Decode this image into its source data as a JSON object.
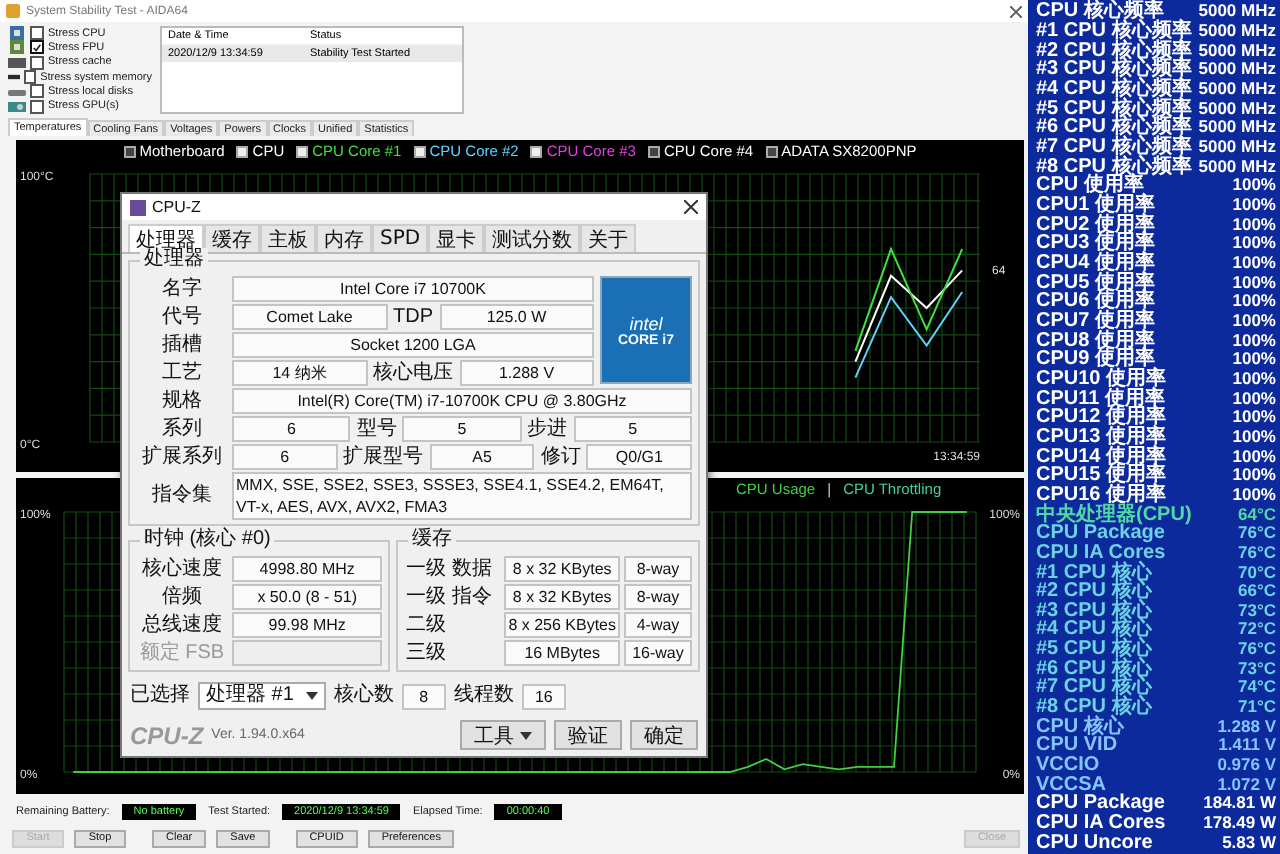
{
  "window": {
    "title": "System Stability Test - AIDA64"
  },
  "stress_options": [
    {
      "label": "Stress CPU",
      "checked": false,
      "kind": "cpu"
    },
    {
      "label": "Stress FPU",
      "checked": true,
      "kind": "fpu"
    },
    {
      "label": "Stress cache",
      "checked": false,
      "kind": "cache"
    },
    {
      "label": "Stress system memory",
      "checked": false,
      "kind": "memory"
    },
    {
      "label": "Stress local disks",
      "checked": false,
      "kind": "disk"
    },
    {
      "label": "Stress GPU(s)",
      "checked": false,
      "kind": "gpu"
    }
  ],
  "log": {
    "columns": [
      "Date & Time",
      "Status"
    ],
    "rows": [
      [
        "2020/12/9 13:34:59",
        "Stability Test Started"
      ]
    ]
  },
  "tabs": [
    {
      "label": "Temperatures",
      "selected": true
    },
    {
      "label": "Cooling Fans",
      "selected": false
    },
    {
      "label": "Voltages",
      "selected": false
    },
    {
      "label": "Powers",
      "selected": false
    },
    {
      "label": "Clocks",
      "selected": false
    },
    {
      "label": "Unified",
      "selected": false
    },
    {
      "label": "Statistics",
      "selected": false
    }
  ],
  "temperature_chart": {
    "legend": [
      {
        "label": "Motherboard",
        "color": "#ffffff",
        "checked": false
      },
      {
        "checked": true
      },
      {
        "checked": true
      },
      {
        "checked": true
      },
      {
        "label": "CPU Core #3",
        "color": "#e040e0",
        "checked": true
      },
      {
        "label": "CPU Core #4",
        "color": "#ffffff",
        "checked": false
      },
      {
        "label": "ADATA SX8200PNP",
        "color": "#ffffff",
        "checked": false
      }
    ],
    "time_label": "13:34:59",
    "chart_data": {
      "type": "line",
      "grid": true,
      "categories": [
        null,
        null,
        null,
        null,
        null,
        null,
        null,
        null,
        null,
        null,
        null,
        null,
        null,
        null,
        null,
        null,
        null,
        null,
        null,
        null,
        null,
        null,
        null,
        null,
        null
      ],
      "ylim": [
        0,
        100
      ],
      "yticks": [
        {
          "value": 100,
          "label": "100°C"
        },
        {
          "value": 0,
          "label": "0°C"
        }
      ],
      "series": [
        {
          "name": "CPU",
          "color": "#ffffff",
          "values": [
            null,
            null,
            null,
            null,
            null,
            null,
            null,
            null,
            null,
            null,
            null,
            null,
            null,
            null,
            null,
            null,
            null,
            null,
            null,
            null,
            null,
            30,
            62,
            50,
            64
          ]
        },
        {
          "name": "CPU Core #1",
          "color": "#40e040",
          "values": [
            null,
            null,
            null,
            null,
            null,
            null,
            null,
            null,
            null,
            null,
            null,
            null,
            null,
            null,
            null,
            null,
            null,
            null,
            null,
            null,
            null,
            34,
            72,
            42,
            72
          ]
        },
        {
          "name": "CPU Core #2",
          "color": "#60d0ff",
          "values": [
            null,
            null,
            null,
            null,
            null,
            null,
            null,
            null,
            null,
            null,
            null,
            null,
            null,
            null,
            null,
            null,
            null,
            null,
            null,
            null,
            null,
            24,
            54,
            36,
            56
          ]
        }
      ],
      "annotations": [
        {
          "text": "64"
        }
      ]
    }
  },
  "usage_chart": {
    "separator": "|",
    "right_ticks": [
      "100%",
      "0%"
    ],
    "chart_data": {
      "type": "line",
      "grid": true,
      "categories": [
        null,
        null,
        null,
        null,
        null,
        null,
        null,
        null,
        null,
        null,
        null,
        null,
        null,
        null,
        null,
        null,
        null,
        null,
        null,
        null,
        null,
        null,
        null,
        null,
        null,
        null,
        null,
        null,
        null,
        null,
        null,
        null,
        null,
        null,
        null,
        null,
        null,
        null,
        null,
        null,
        null,
        null,
        null,
        null,
        null,
        null,
        null,
        null,
        null,
        null
      ],
      "ylim": [
        0,
        100
      ],
      "yticks": [
        {
          "value": 100,
          "label": "100%"
        },
        {
          "value": 0,
          "label": "0%"
        }
      ],
      "series": [
        {
          "name": "CPU Usage",
          "color": "#40d040",
          "values": [
            0,
            0,
            0,
            0,
            0,
            0,
            0,
            0,
            0,
            0,
            0,
            0,
            0,
            0,
            0,
            0,
            0,
            0,
            0,
            0,
            0,
            0,
            0,
            0,
            0,
            0,
            0,
            0,
            0,
            0,
            0,
            0,
            0,
            0,
            0,
            0,
            0,
            2,
            5,
            1,
            3,
            2,
            1,
            2,
            2,
            2,
            100,
            100,
            100,
            100
          ]
        },
        {
          "name": "CPU Throttling",
          "color": "#40d0a0",
          "values": [
            null,
            null,
            null,
            null,
            null,
            null,
            null,
            null,
            null,
            null,
            null,
            null,
            null,
            null,
            null,
            null,
            null,
            null,
            null,
            null,
            null,
            null,
            null,
            null,
            null,
            null,
            null,
            null,
            null,
            null,
            null,
            null,
            null,
            null,
            null,
            null,
            null,
            null,
            null,
            null,
            null,
            null,
            null,
            null,
            null,
            null,
            null,
            null,
            null,
            null
          ]
        }
      ]
    }
  },
  "cpuz": {
    "title": "CPU-Z",
    "tabs": [
      {
        "label": "处理器",
        "selected": true
      },
      {
        "label": "缓存",
        "selected": false
      },
      {
        "label": "主板",
        "selected": false
      },
      {
        "label": "内存",
        "selected": false
      },
      {
        "label": "SPD",
        "selected": false
      },
      {
        "label": "显卡",
        "selected": false
      },
      {
        "label": "测试分数",
        "selected": false
      },
      {
        "label": "关于",
        "selected": false
      }
    ],
    "processor": {
      "heading": "处理器",
      "logo": {
        "brand": "intel",
        "line": "CORE i7"
      },
      "rows": [
        [
          {
            "label": "名字",
            "value": "Intel Core i7 10700K"
          }
        ],
        [
          {
            "label": "代号",
            "value": "Comet Lake"
          },
          {
            "label": "TDP",
            "value": "125.0 W"
          }
        ],
        [
          {
            "label": "插槽",
            "value": "Socket 1200 LGA"
          }
        ],
        [
          {
            "label": "工艺",
            "value": "14 纳米"
          },
          {
            "label": "核心电压",
            "value": "1.288 V"
          }
        ],
        [
          {
            "label": "规格",
            "value": "Intel(R) Core(TM) i7-10700K CPU @ 3.80GHz"
          }
        ],
        [
          {
            "label": "系列",
            "value": "6"
          },
          {
            "label": "型号",
            "value": "5"
          },
          {
            "label": "步进",
            "value": "5"
          }
        ],
        [
          {
            "label": "扩展系列",
            "value": "6"
          },
          {
            "label": "扩展型号",
            "value": "A5"
          },
          {
            "label": "修订",
            "value": "Q0/G1"
          }
        ],
        [
          {
            "label": "指令集",
            "value": "MMX, SSE, SSE2, SSE3, SSSE3, SSE4.1, SSE4.2, EM64T, VT-x, AES, AVX, AVX2, FMA3"
          }
        ]
      ]
    },
    "clocks": {
      "heading": "时钟 (核心 #0)",
      "rows": [
        {
          "label": "核心速度",
          "value": "4998.80 MHz",
          "disabled": false
        },
        {
          "label": "倍频",
          "value": "x 50.0 (8 - 51)",
          "disabled": false
        },
        {
          "label": "总线速度",
          "value": "99.98 MHz",
          "disabled": false
        },
        {
          "label": "额定 FSB",
          "disabled": true
        }
      ]
    },
    "cache": {
      "heading": "缓存",
      "rows": [
        [
          "一级 数据",
          "8 x 32 KBytes",
          "8-way"
        ],
        [
          "一级 指令",
          "8 x 32 KBytes",
          "8-way"
        ],
        [
          "二级",
          "8 x 256 KBytes",
          "4-way"
        ],
        [
          "三级",
          "16 MBytes",
          "16-way"
        ]
      ]
    },
    "selection": {
      "label": "已选择",
      "value": "处理器 #1",
      "cores_label": "核心数",
      "cores": "8",
      "threads_label": "线程数",
      "threads": "16"
    },
    "footer": {
      "brand": "CPU-Z",
      "version": "Ver. 1.94.0.x64",
      "buttons": [
        "工具",
        "验证",
        "确定"
      ]
    }
  },
  "status": [
    {
      "label": "Remaining Battery:",
      "value": "No battery"
    },
    {
      "label": "Test Started:",
      "value": "2020/12/9 13:34:59"
    },
    {
      "label": "Elapsed Time:",
      "value": "00:00:40"
    }
  ],
  "buttons": [
    {
      "label": "Start",
      "disabled": true
    },
    {
      "label": "Stop",
      "disabled": false
    },
    {
      "label": "Clear",
      "disabled": false
    },
    {
      "label": "Save",
      "disabled": false
    },
    {
      "label": "CPUID",
      "disabled": false
    },
    {
      "label": "Preferences",
      "disabled": false
    },
    {
      "label": "Close",
      "disabled": true
    }
  ],
  "sensors": [
    {
      "label": "CPU 核心频率",
      "value": "5000 MHz",
      "color": "#ffffff"
    },
    {
      "label": "#1 CPU 核心频率",
      "value": "5000 MHz",
      "color": "#ffffff"
    },
    {
      "label": "#2 CPU 核心频率",
      "value": "5000 MHz",
      "color": "#ffffff"
    },
    {
      "label": "#3 CPU 核心频率",
      "value": "5000 MHz",
      "color": "#ffffff"
    },
    {
      "label": "#4 CPU 核心频率",
      "value": "5000 MHz",
      "color": "#ffffff"
    },
    {
      "label": "#5 CPU 核心频率",
      "value": "5000 MHz",
      "color": "#ffffff"
    },
    {
      "label": "#6 CPU 核心频率",
      "value": "5000 MHz",
      "color": "#ffffff"
    },
    {
      "label": "#7 CPU 核心频率",
      "value": "5000 MHz",
      "color": "#ffffff"
    },
    {
      "label": "#8 CPU 核心频率",
      "value": "5000 MHz",
      "color": "#ffffff"
    },
    {
      "label": "CPU 使用率",
      "value": "100%",
      "color": "#ffffff"
    },
    {
      "label": "CPU1 使用率",
      "value": "100%",
      "color": "#ffffff"
    },
    {
      "label": "CPU2 使用率",
      "value": "100%",
      "color": "#ffffff"
    },
    {
      "label": "CPU3 使用率",
      "value": "100%",
      "color": "#ffffff"
    },
    {
      "label": "CPU4 使用率",
      "value": "100%",
      "color": "#ffffff"
    },
    {
      "label": "CPU5 使用率",
      "value": "100%",
      "color": "#ffffff"
    },
    {
      "label": "CPU6 使用率",
      "value": "100%",
      "color": "#ffffff"
    },
    {
      "label": "CPU7 使用率",
      "value": "100%",
      "color": "#ffffff"
    },
    {
      "label": "CPU8 使用率",
      "value": "100%",
      "color": "#ffffff"
    },
    {
      "label": "CPU9 使用率",
      "value": "100%",
      "color": "#ffffff"
    },
    {
      "label": "CPU10 使用率",
      "value": "100%",
      "color": "#ffffff"
    },
    {
      "label": "CPU11 使用率",
      "value": "100%",
      "color": "#ffffff"
    },
    {
      "label": "CPU12 使用率",
      "value": "100%",
      "color": "#ffffff"
    },
    {
      "label": "CPU13 使用率",
      "value": "100%",
      "color": "#ffffff"
    },
    {
      "label": "CPU14 使用率",
      "value": "100%",
      "color": "#ffffff"
    },
    {
      "label": "CPU15 使用率",
      "value": "100%",
      "color": "#ffffff"
    },
    {
      "label": "CPU16 使用率",
      "value": "100%",
      "color": "#ffffff"
    },
    {
      "label": "中央处理器(CPU)",
      "value": "64°C",
      "color": "#50d8a8"
    },
    {
      "label": "CPU Package",
      "value": "76°C",
      "color": "#6cd2e6"
    },
    {
      "label": "CPU IA Cores",
      "value": "76°C",
      "color": "#6cd2e6"
    },
    {
      "label": "#1 CPU 核心",
      "value": "70°C",
      "color": "#6cd2e6"
    },
    {
      "label": "#2 CPU 核心",
      "value": "66°C",
      "color": "#6cd2e6"
    },
    {
      "label": "#3 CPU 核心",
      "value": "73°C",
      "color": "#6cd2e6"
    },
    {
      "label": "#4 CPU 核心",
      "value": "72°C",
      "color": "#6cd2e6"
    },
    {
      "label": "#5 CPU 核心",
      "value": "76°C",
      "color": "#6cd2e6"
    },
    {
      "label": "#6 CPU 核心",
      "value": "73°C",
      "color": "#6cd2e6"
    },
    {
      "label": "#7 CPU 核心",
      "value": "74°C",
      "color": "#6cd2e6"
    },
    {
      "label": "#8 CPU 核心",
      "value": "71°C",
      "color": "#6cd2e6"
    },
    {
      "label": "CPU 核心",
      "value": "1.288 V",
      "color": "#86c4ff"
    },
    {
      "label": "CPU VID",
      "value": "1.411 V",
      "color": "#86c4ff"
    },
    {
      "label": "VCCIO",
      "value": "0.976 V",
      "color": "#86c4ff"
    },
    {
      "label": "VCCSA",
      "value": "1.072 V",
      "color": "#86c4ff"
    },
    {
      "label": "CPU Package",
      "value": "184.81 W",
      "color": "#ffffff"
    },
    {
      "label": "CPU IA Cores",
      "value": "178.49 W",
      "color": "#ffffff"
    },
    {
      "label": "CPU Uncore",
      "value": "5.83 W",
      "color": "#ffffff"
    }
  ]
}
